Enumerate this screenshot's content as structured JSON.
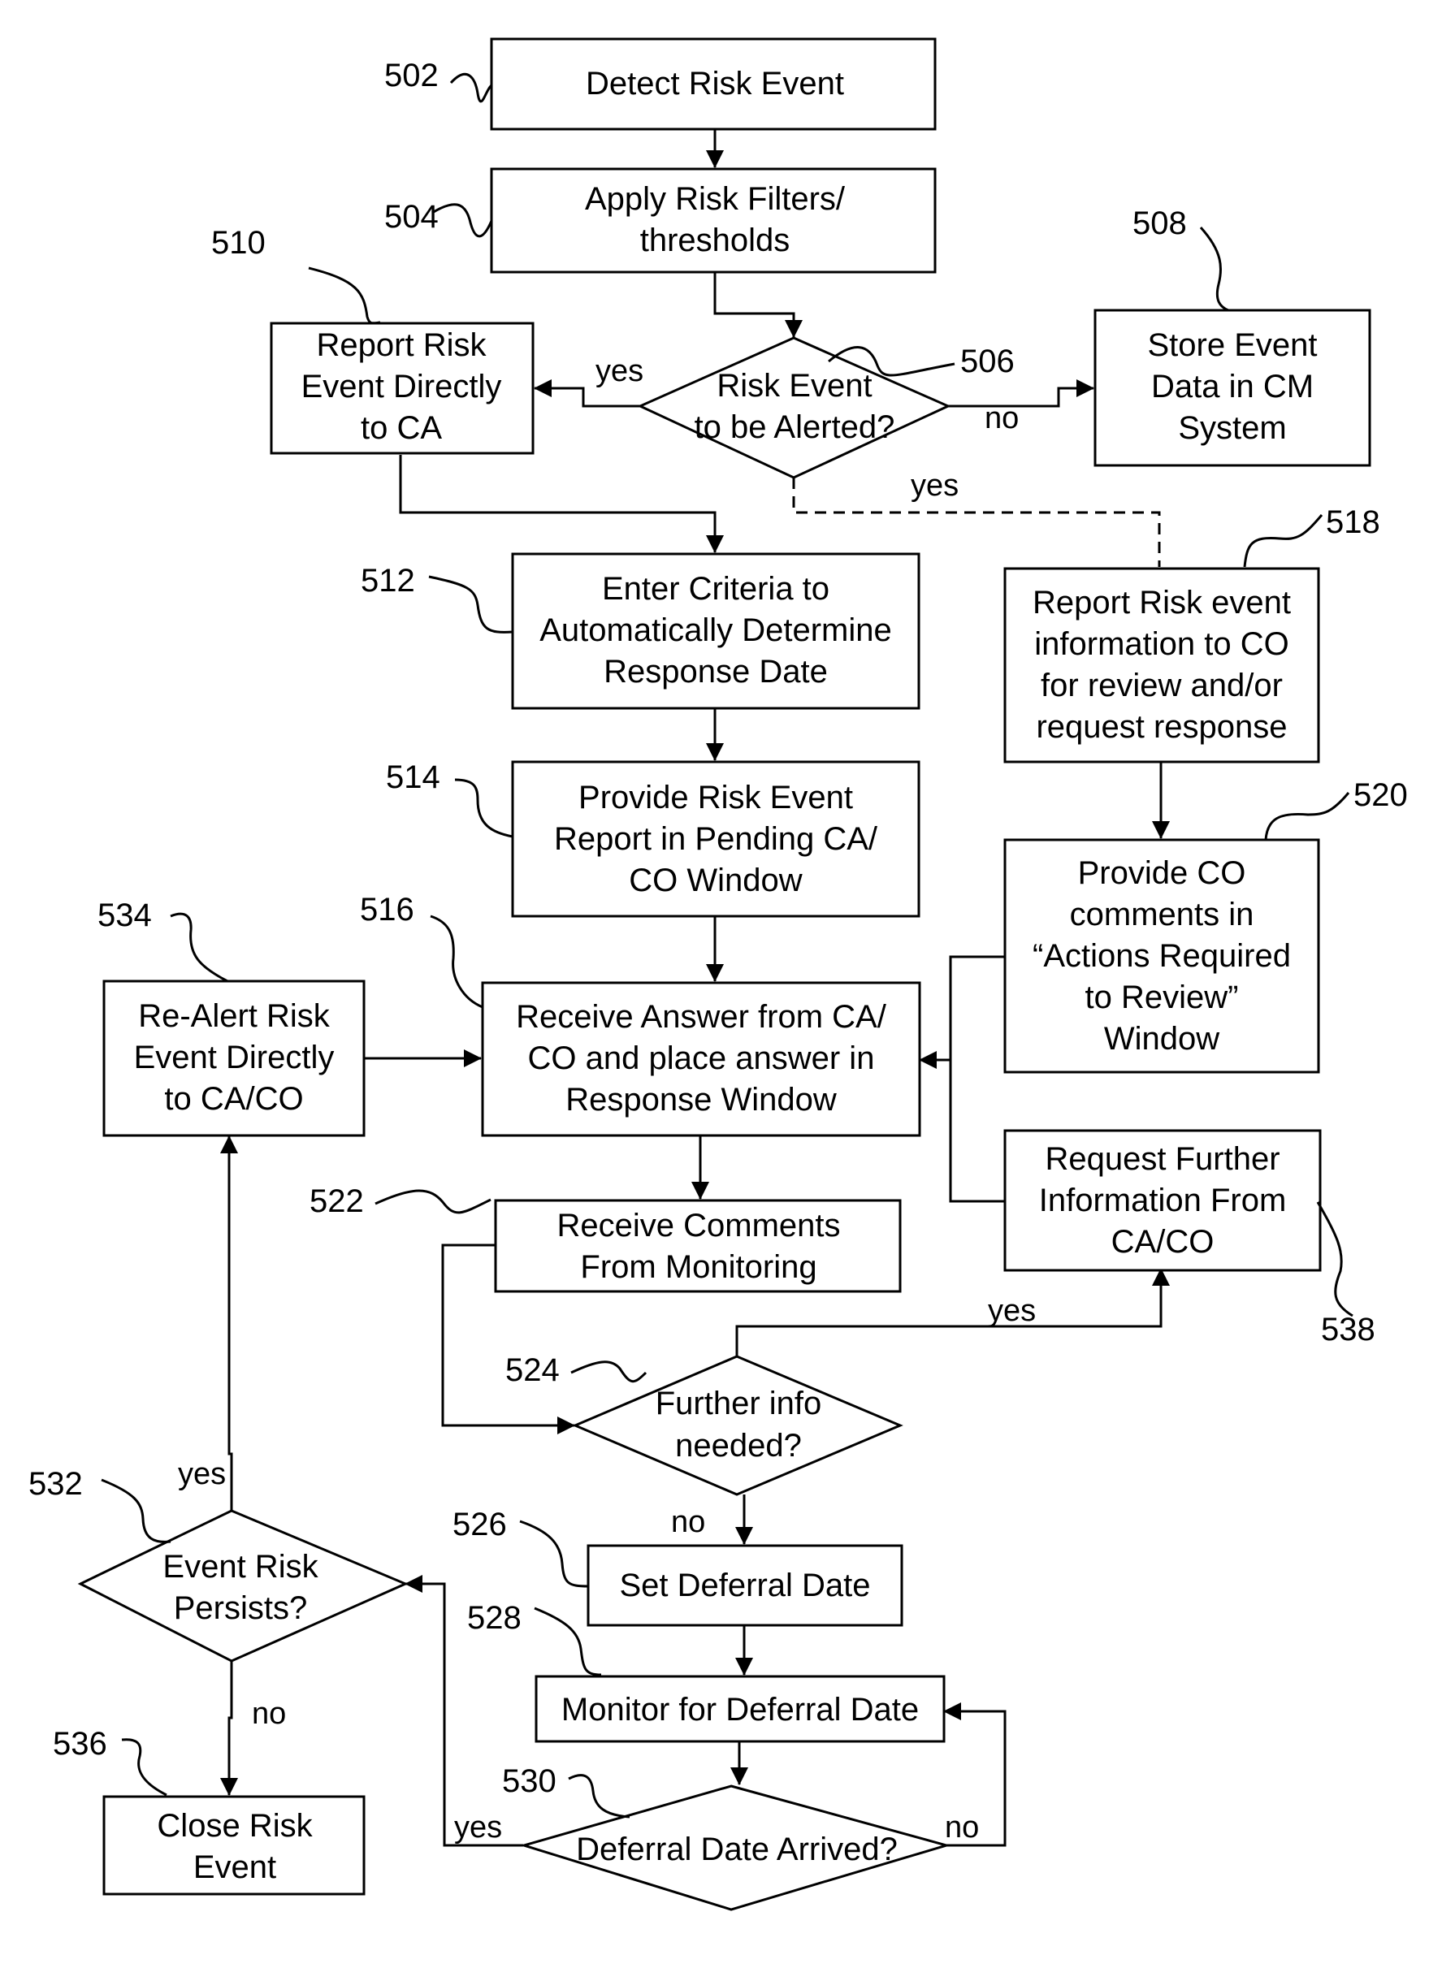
{
  "figure": {
    "nodes": [
      {
        "id": "502",
        "type": "process",
        "ref": "502",
        "lines": [
          "Detect Risk Event"
        ]
      },
      {
        "id": "504",
        "type": "process",
        "ref": "504",
        "lines": [
          "Apply Risk Filters/",
          "thresholds"
        ]
      },
      {
        "id": "506",
        "type": "decision",
        "ref": "506",
        "lines": [
          "Risk Event",
          "to be Alerted?"
        ]
      },
      {
        "id": "508",
        "type": "process",
        "ref": "508",
        "lines": [
          "Store Event",
          "Data in CM",
          "System"
        ]
      },
      {
        "id": "510",
        "type": "process",
        "ref": "510",
        "lines": [
          "Report Risk",
          "Event Directly",
          "to CA"
        ]
      },
      {
        "id": "512",
        "type": "process",
        "ref": "512",
        "lines": [
          "Enter Criteria to",
          "Automatically Determine",
          "Response Date"
        ]
      },
      {
        "id": "514",
        "type": "process",
        "ref": "514",
        "lines": [
          "Provide Risk Event",
          "Report in Pending CA/",
          "CO Window"
        ]
      },
      {
        "id": "516",
        "type": "process",
        "ref": "516",
        "lines": [
          "Receive Answer from CA/",
          "CO and place answer in",
          "Response Window"
        ]
      },
      {
        "id": "518",
        "type": "process",
        "ref": "518",
        "lines": [
          "Report Risk event",
          "information to CO",
          "for review and/or",
          "request  response"
        ]
      },
      {
        "id": "520",
        "type": "process",
        "ref": "520",
        "lines": [
          "Provide CO",
          "comments in",
          "“Actions Required",
          "to Review”",
          "Window"
        ]
      },
      {
        "id": "522",
        "type": "process",
        "ref": "522",
        "lines": [
          "Receive Comments",
          "From Monitoring"
        ]
      },
      {
        "id": "524",
        "type": "decision",
        "ref": "524",
        "lines": [
          "Further info",
          "needed?"
        ]
      },
      {
        "id": "526",
        "type": "process",
        "ref": "526",
        "lines": [
          "Set Deferral Date"
        ]
      },
      {
        "id": "528",
        "type": "process",
        "ref": "528",
        "lines": [
          "Monitor for Deferral Date"
        ]
      },
      {
        "id": "530",
        "type": "decision",
        "ref": "530",
        "lines": [
          "Deferral Date Arrived?"
        ]
      },
      {
        "id": "532",
        "type": "decision",
        "ref": "532",
        "lines": [
          "Event Risk",
          "Persists?"
        ]
      },
      {
        "id": "534",
        "type": "process",
        "ref": "534",
        "lines": [
          "Re-Alert Risk",
          "Event Directly",
          "to CA/CO"
        ]
      },
      {
        "id": "536",
        "type": "process",
        "ref": "536",
        "lines": [
          "Close Risk",
          "Event"
        ]
      },
      {
        "id": "538",
        "type": "process",
        "ref": "538",
        "lines": [
          "Request Further",
          "Information From",
          "CA/CO"
        ]
      }
    ],
    "edges": [
      {
        "from": "502",
        "to": "504",
        "label": ""
      },
      {
        "from": "504",
        "to": "506",
        "label": ""
      },
      {
        "from": "506",
        "to": "510",
        "label": "yes"
      },
      {
        "from": "506",
        "to": "508",
        "label": "no"
      },
      {
        "from": "506",
        "to": "518",
        "label": "yes",
        "style": "dashed"
      },
      {
        "from": "510",
        "to": "512",
        "label": ""
      },
      {
        "from": "512",
        "to": "514",
        "label": ""
      },
      {
        "from": "514",
        "to": "516",
        "label": ""
      },
      {
        "from": "518",
        "to": "520",
        "label": ""
      },
      {
        "from": "520",
        "to": "516",
        "label": ""
      },
      {
        "from": "538",
        "to": "516",
        "label": ""
      },
      {
        "from": "534",
        "to": "516",
        "label": ""
      },
      {
        "from": "516",
        "to": "522",
        "label": ""
      },
      {
        "from": "522",
        "to": "524",
        "label": ""
      },
      {
        "from": "524",
        "to": "538",
        "label": "yes"
      },
      {
        "from": "524",
        "to": "526",
        "label": "no"
      },
      {
        "from": "526",
        "to": "528",
        "label": ""
      },
      {
        "from": "528",
        "to": "530",
        "label": ""
      },
      {
        "from": "530",
        "to": "528",
        "label": "no"
      },
      {
        "from": "530",
        "to": "532",
        "label": "yes"
      },
      {
        "from": "532",
        "to": "534",
        "label": "yes"
      },
      {
        "from": "532",
        "to": "536",
        "label": "no"
      }
    ]
  }
}
